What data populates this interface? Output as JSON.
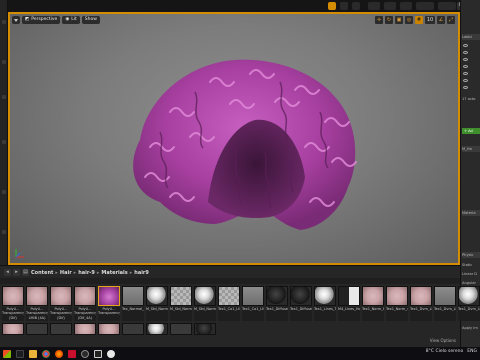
{
  "viewport": {
    "perspective_label": "Perspective",
    "lit_label": "Lit",
    "show_label": "Show",
    "right_value": "10",
    "accent": "#d48c00"
  },
  "topbar": {
    "right_label": "Ma"
  },
  "details": {
    "header": "Lobbi",
    "count_text": "17 acto",
    "green_btn": "+ Ad",
    "field_name": "M_Ha",
    "section": "Materia",
    "physics_header": "Physic",
    "rows": [
      "Static",
      "Linear D",
      "Angular",
      "Enable",
      "Constrai",
      "Ignore R",
      "Mass",
      "Apply Im"
    ]
  },
  "content_browser": {
    "breadcrumb": [
      "Content",
      "Hair",
      "hair-9",
      "Materials",
      "hair9"
    ],
    "item_count": "",
    "view_options": "View Options",
    "assets": [
      {
        "label": "PolyU... Transparency (Dif)",
        "style": "pinkish"
      },
      {
        "label": "PolyU... Transparency LMIB (4A)",
        "style": "pinkish"
      },
      {
        "label": "PolyU... Transparency (Dif)",
        "style": "pinkish"
      },
      {
        "label": "PolyU... Transparency (Dif_4A)",
        "style": "pinkish"
      },
      {
        "label": "PolyU... Transparency",
        "style": "pinkhair"
      },
      {
        "label": "Tex_Normal_3_LMFB_4x4",
        "style": "gray"
      },
      {
        "label": "M_Std_Normal_9_LMFB_4x4",
        "style": "sphere-w"
      },
      {
        "label": "M_Std_Normal_9_LMFB_4x4",
        "style": "checker"
      },
      {
        "label": "M_Std_Normal_9_LMFB_4x4",
        "style": "sphere-w"
      },
      {
        "label": "Tex1_Co1_LMFB_4x4",
        "style": "checker"
      },
      {
        "label": "Tex1_Co1_LMFB_4x4",
        "style": "gray"
      },
      {
        "label": "Tex1_Diffuse_LMFB_4x4",
        "style": "sphere-d"
      },
      {
        "label": "Tex1_Diffuse_LMFB_4x4",
        "style": "sphere-d"
      },
      {
        "label": "Tex1_Lines_Tres_4x4",
        "style": "sphere-w"
      },
      {
        "label": "M4_Lines_Hore_4x4_4x4",
        "style": "half"
      },
      {
        "label": "Tex1_Norm_Hi1_4x4",
        "style": "pinkish"
      },
      {
        "label": "Tex1_Norm_4x4",
        "style": "pinkish"
      },
      {
        "label": "Tex1_Dvm_LMFB_4x4",
        "style": "pinkish"
      },
      {
        "label": "Tex1_Dvm_LMFB_4x4",
        "style": "gray"
      },
      {
        "label": "Tex1_Dvm_LMFB_4x4",
        "style": "sphere-w"
      }
    ],
    "row2": [
      "pinkish",
      "dark",
      "dark",
      "pinkish",
      "pinkish",
      "dark",
      "sphere-w",
      "dark",
      "sphere-d"
    ]
  },
  "taskbar": {
    "locale": "ENG",
    "tray_text": "8°C  Cielo sereno",
    "icons": [
      "start-icon",
      "search-icon",
      "file-explorer-icon",
      "chrome-icon",
      "firefox-icon",
      "acrobat-icon",
      "obs-icon",
      "epic-icon",
      "unreal-icon"
    ]
  }
}
